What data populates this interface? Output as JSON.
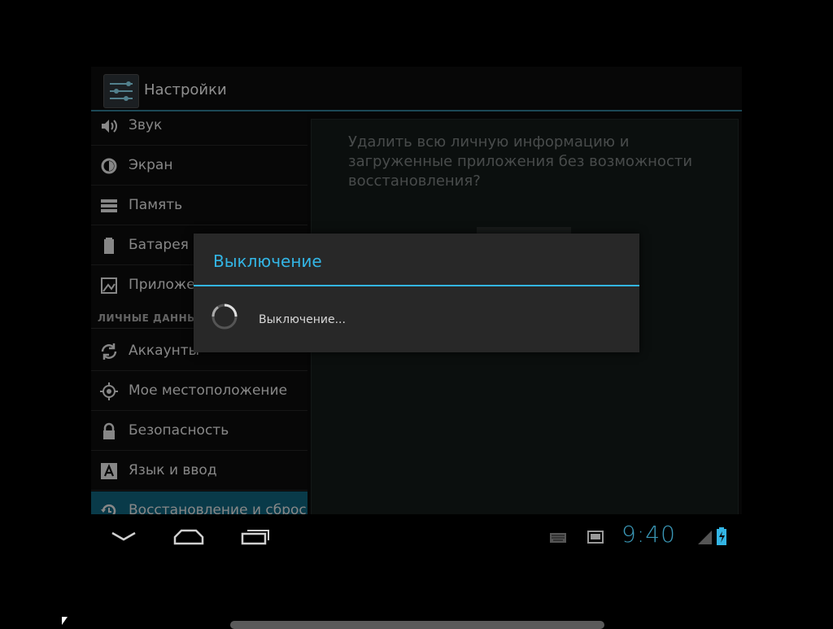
{
  "app": {
    "title": "Настройки",
    "icon": "settings-sliders-icon"
  },
  "sidebar": {
    "items": [
      {
        "label": "Звук",
        "icon": "volume-icon"
      },
      {
        "label": "Экран",
        "icon": "brightness-icon"
      },
      {
        "label": "Память",
        "icon": "storage-icon"
      },
      {
        "label": "Батарея",
        "icon": "battery-icon"
      },
      {
        "label": "Приложения",
        "icon": "apps-icon"
      }
    ],
    "section_personal": "ЛИЧНЫЕ ДАННЫЕ",
    "items2": [
      {
        "label": "Аккаунты",
        "icon": "sync-icon"
      },
      {
        "label": "Мое местоположение",
        "icon": "location-icon"
      },
      {
        "label": "Безопасность",
        "icon": "lock-icon"
      },
      {
        "label": "Язык и ввод",
        "icon": "keyboard-language-icon"
      },
      {
        "label": "Восстановление и сброс",
        "icon": "restore-icon",
        "active": true
      }
    ]
  },
  "content": {
    "text": "Удалить всю личную информацию и загруженные приложения без возможности восстановления?"
  },
  "dialog": {
    "title": "Выключение",
    "message": "Выключение..."
  },
  "navbar": {
    "buttons": [
      "back",
      "home",
      "recent-apps"
    ],
    "time": "9:40"
  },
  "colors": {
    "accent": "#33b5e5",
    "active_item": "#0f5a70",
    "background": "#000000"
  }
}
